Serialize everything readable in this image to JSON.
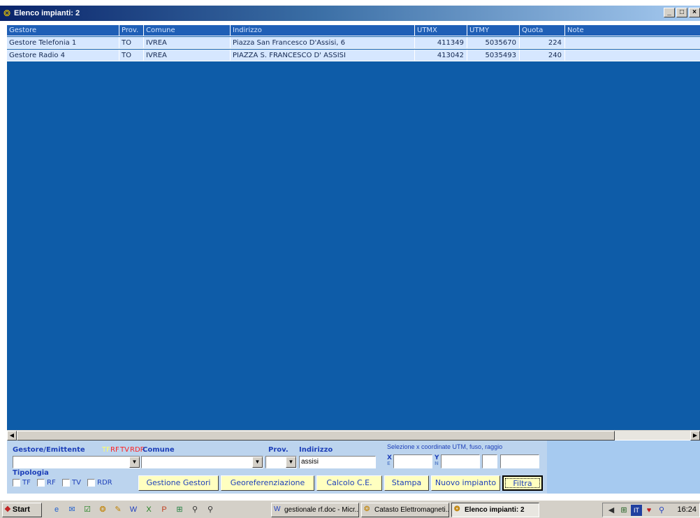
{
  "window": {
    "title": "Elenco impianti: 2",
    "controls": [
      "_",
      "□",
      "×"
    ]
  },
  "table": {
    "columns": [
      "Gestore",
      "Prov.",
      "Comune",
      "Indirizzo",
      "UTMX",
      "UTMY",
      "Quota",
      "Note"
    ],
    "rows": [
      [
        "Gestore Telefonia 1",
        "TO",
        "IVREA",
        "Piazza San Francesco D'Assisi, 6",
        "411349",
        "5035670",
        "224",
        ""
      ],
      [
        "Gestore Radio 4",
        "TO",
        "IVREA",
        "PIAZZA S. FRANCESCO D' ASSISI",
        "413042",
        "5035493",
        "240",
        ""
      ]
    ]
  },
  "filter": {
    "gestore_label": "Gestore/Emittente",
    "type_tags": [
      {
        "text": "TF",
        "color": "#ffff66"
      },
      {
        "text": "RF",
        "color": "#ff2020"
      },
      {
        "text": "TV",
        "color": "#ff2020"
      },
      {
        "text": "RDR",
        "color": "#ff2020"
      }
    ],
    "comune_label": "Comune",
    "prov_label": "Prov.",
    "indirizzo_label": "Indirizzo",
    "indirizzo_value": "assisi",
    "utm_label": "Selezione x coordinate UTM, fuso, raggio",
    "x_label": "X",
    "x_sub": "E",
    "y_label": "Y",
    "y_sub": "N",
    "tipologia_label": "Tipologia",
    "checkboxes": [
      "TF",
      "RF",
      "TV",
      "RDR"
    ],
    "buttons": {
      "gestione": "Gestione Gestori",
      "georef": "Georeferenziazione",
      "calcolo": "Calcolo C.E.",
      "stampa": "Stampa",
      "nuovo": "Nuovo impianto",
      "filtra": "Filtra"
    }
  },
  "taskbar": {
    "start": "Start",
    "tasks": [
      {
        "label": "gestionale rf.doc - Micr...",
        "icon": "word-doc-icon"
      },
      {
        "label": "Catasto Elettromagneti...",
        "icon": "app-icon"
      },
      {
        "label": "Elenco impianti: 2",
        "icon": "app-icon",
        "active": true
      }
    ],
    "clock": "16:24"
  }
}
